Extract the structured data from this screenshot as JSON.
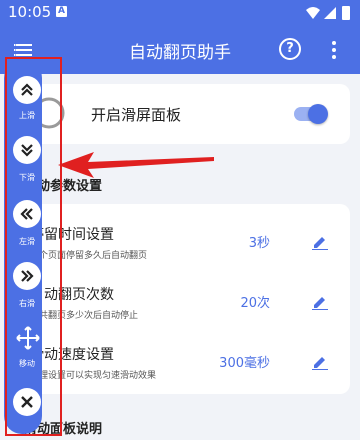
{
  "status_bar": {
    "time": "10:05",
    "notification_badge": "A"
  },
  "app_bar": {
    "title": "自动翻页助手",
    "help_label": "?"
  },
  "toggle_card": {
    "label": "开启滑屏面板",
    "enabled": true
  },
  "sections": {
    "settings_title": "滑动参数设置",
    "panel_help_title": "滑动面板说明"
  },
  "settings": [
    {
      "title": "停留时间设置",
      "desc": "每个页面停留多久后自动翻页",
      "value": "3秒"
    },
    {
      "title": "自动翻页次数",
      "desc": "总共翻页多少次后自动停止",
      "value": "20次"
    },
    {
      "title": "滑动速度设置",
      "desc": "合理设置可以实现匀速滑动效果",
      "value": "300毫秒"
    }
  ],
  "float_panel": {
    "buttons": [
      {
        "label": "上滑",
        "icon": "double-chevron-up-icon"
      },
      {
        "label": "下滑",
        "icon": "double-chevron-down-icon"
      },
      {
        "label": "左滑",
        "icon": "double-chevron-left-icon"
      },
      {
        "label": "右滑",
        "icon": "double-chevron-right-icon"
      },
      {
        "label": "移动",
        "icon": "move-icon"
      },
      {
        "label": "",
        "icon": "close-icon"
      }
    ]
  },
  "colors": {
    "primary": "#4c70e4",
    "annotation": "#e02020",
    "background": "#f1f3f8"
  }
}
